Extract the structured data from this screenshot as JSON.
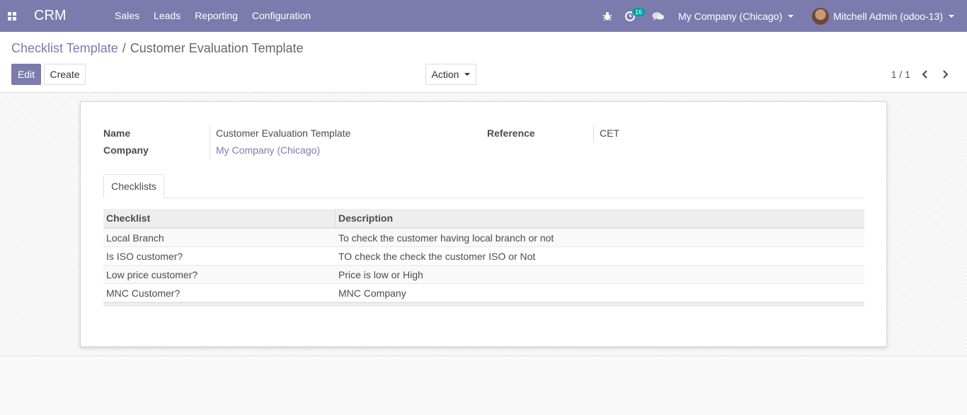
{
  "navbar": {
    "app_name": "CRM",
    "menu": [
      "Sales",
      "Leads",
      "Reporting",
      "Configuration"
    ],
    "activity_count": "16",
    "company": "My Company (Chicago)",
    "user": "Mitchell Admin (odoo-13)"
  },
  "breadcrumb": {
    "parent": "Checklist Template",
    "separator": "/",
    "current": "Customer Evaluation Template"
  },
  "toolbar": {
    "edit_label": "Edit",
    "create_label": "Create",
    "action_label": "Action",
    "pager": "1 / 1"
  },
  "form": {
    "name_label": "Name",
    "name_value": "Customer Evaluation Template",
    "company_label": "Company",
    "company_value": "My Company (Chicago)",
    "reference_label": "Reference",
    "reference_value": "CET"
  },
  "tabs": [
    "Checklists"
  ],
  "table": {
    "headers": [
      "Checklist",
      "Description"
    ],
    "rows": [
      [
        "Local Branch",
        "To check the customer having local branch or not"
      ],
      [
        "Is ISO customer?",
        "TO check the check the customer ISO or Not"
      ],
      [
        "Low price customer?",
        "Price is low or High"
      ],
      [
        "MNC Customer?",
        "MNC Company"
      ]
    ]
  },
  "colors": {
    "brand": "#7c7bad",
    "badge": "#00a09d"
  }
}
